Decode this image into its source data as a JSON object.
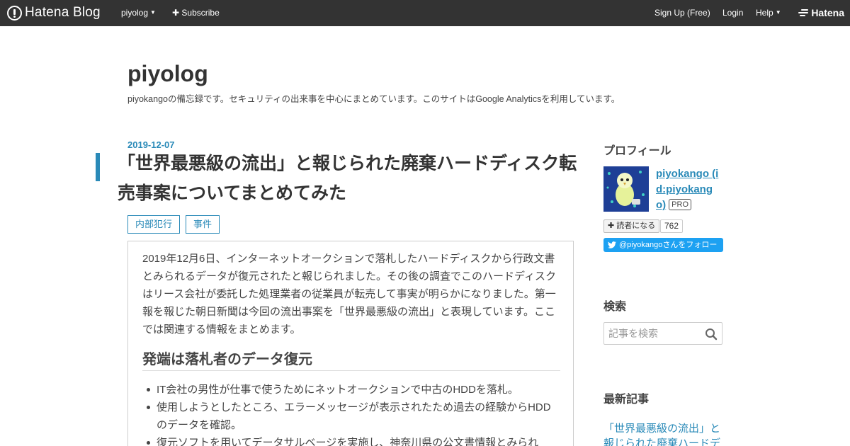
{
  "topbar": {
    "logo_text": "Hatena Blog",
    "blog_menu": "piyolog",
    "subscribe": "Subscribe",
    "signup": "Sign Up (Free)",
    "login": "Login",
    "help": "Help",
    "brand": "Hatena"
  },
  "blog": {
    "title": "piyolog",
    "description": "piyokangoの備忘録です。セキュリティの出来事を中心にまとめています。このサイトはGoogle Analyticsを利用しています。"
  },
  "article": {
    "date": "2019-12-07",
    "title": "「世界最悪級の流出」と報じられた廃棄ハードディスク転売事案についてまとめてみた",
    "categories": [
      "内部犯行",
      "事件"
    ],
    "intro": "2019年12月6日、インターネットオークションで落札したハードディスクから行政文書とみられるデータが復元されたと報じられました。その後の調査でこのハードディスクはリース会社が委託した処理業者の従業員が転売して事実が明らかになりました。第一報を報じた朝日新聞は今回の流出事案を「世界最悪級の流出」と表現しています。ここでは関連する情報をまとめます。",
    "heading": "発端は落札者のデータ復元",
    "bullets": [
      "IT会社の男性が仕事で使うためにネットオークションで中古のHDDを落札。",
      "使用しようとしたところ、エラーメッセージが表示されたため過去の経験からHDDのデータを確認。",
      "復元ソフトを用いてデータサルベージを実施し、神奈川県の公文書情報とみられ"
    ]
  },
  "sidebar": {
    "profile_heading": "プロフィール",
    "profile_name": "piyokango (id:piyokango)",
    "pro_badge": "PRO",
    "reader_button": "読者になる",
    "reader_count": "762",
    "twitter_follow": "@piyokangoさんをフォロー",
    "search_heading": "検索",
    "search_placeholder": "記事を検索",
    "recent_heading": "最新記事",
    "recent_link": "「世界最悪級の流出」と報じられた廃棄ハードデ"
  },
  "colors": {
    "accent": "#2a8ab8",
    "topbar": "#333333",
    "twitter": "#1da1f2"
  }
}
